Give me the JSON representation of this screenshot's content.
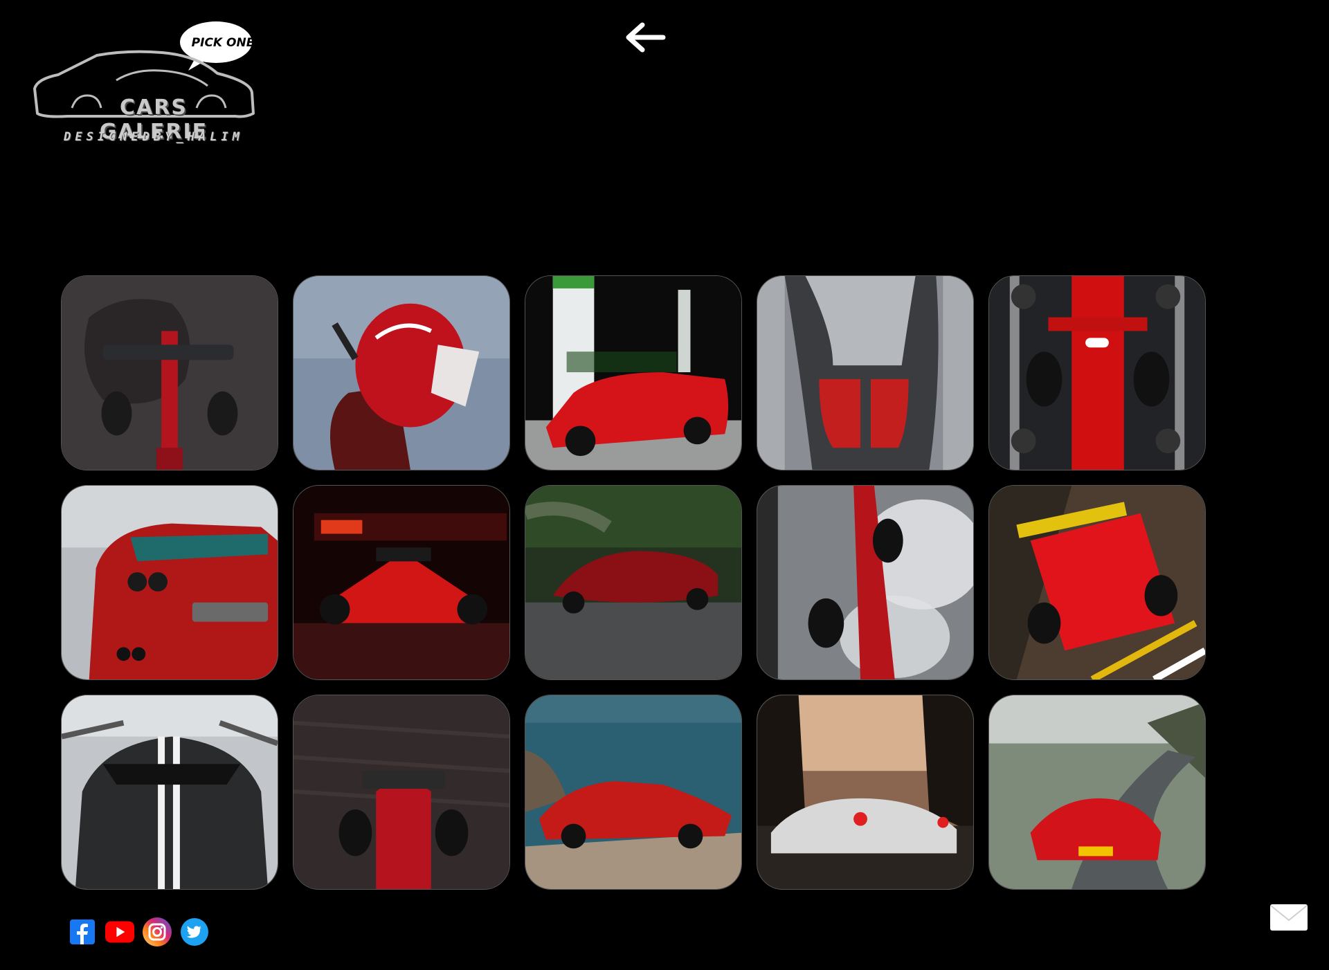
{
  "brand": {
    "bubble_text": "PICK ONE",
    "title": "CARS GALERIE",
    "subtitle": "DESIGNEDBY_HALIM"
  },
  "nav": {
    "back_icon": "arrow-left-icon"
  },
  "gallery": {
    "items": [
      {
        "name": "gallery-card-f1-top-horse",
        "bg": "#3a3536",
        "accent": "#b3141e"
      },
      {
        "name": "gallery-card-driver-helmet",
        "bg": "#7a8aa0",
        "accent": "#c0121c"
      },
      {
        "name": "gallery-card-f40-gas-station",
        "bg": "#0d0d0d",
        "accent": "#d5141a"
      },
      {
        "name": "gallery-card-monza-top",
        "bg": "#6d7075",
        "accent": "#c41f1f"
      },
      {
        "name": "gallery-card-f1-pitstop",
        "bg": "#1e1f22",
        "accent": "#d01010"
      },
      {
        "name": "gallery-card-812-superfast",
        "bg": "#b8bcc0",
        "accent": "#b01818"
      },
      {
        "name": "gallery-card-f1-night-16",
        "bg": "#1a0606",
        "accent": "#d21515"
      },
      {
        "name": "gallery-card-laferrari-forest",
        "bg": "#2a3430",
        "accent": "#8a1015"
      },
      {
        "name": "gallery-card-f1-burnout",
        "bg": "#9ea2a8",
        "accent": "#b5141a"
      },
      {
        "name": "gallery-card-f1-track-top",
        "bg": "#5b4a38",
        "accent": "#e0141a"
      },
      {
        "name": "gallery-card-488-pista-grey",
        "bg": "#c7cbcf",
        "accent": "#2a2b2d"
      },
      {
        "name": "gallery-card-f1-motion",
        "bg": "#3a3030",
        "accent": "#b5141e"
      },
      {
        "name": "gallery-card-308-coast",
        "bg": "#2f5f70",
        "accent": "#c41a18"
      },
      {
        "name": "gallery-card-488-sunset",
        "bg": "#c49a78",
        "accent": "#d8d8d8"
      },
      {
        "name": "gallery-card-laferrari-mountain",
        "bg": "#7b8a78",
        "accent": "#d2141a"
      }
    ]
  },
  "footer": {
    "social": [
      {
        "name": "facebook-icon",
        "color": "#1877f2"
      },
      {
        "name": "youtube-icon",
        "color": "#ff0000"
      },
      {
        "name": "instagram-icon",
        "color": "#e1306c"
      },
      {
        "name": "twitter-icon",
        "color": "#1da1f2"
      }
    ],
    "mail_icon": "mail-icon"
  }
}
